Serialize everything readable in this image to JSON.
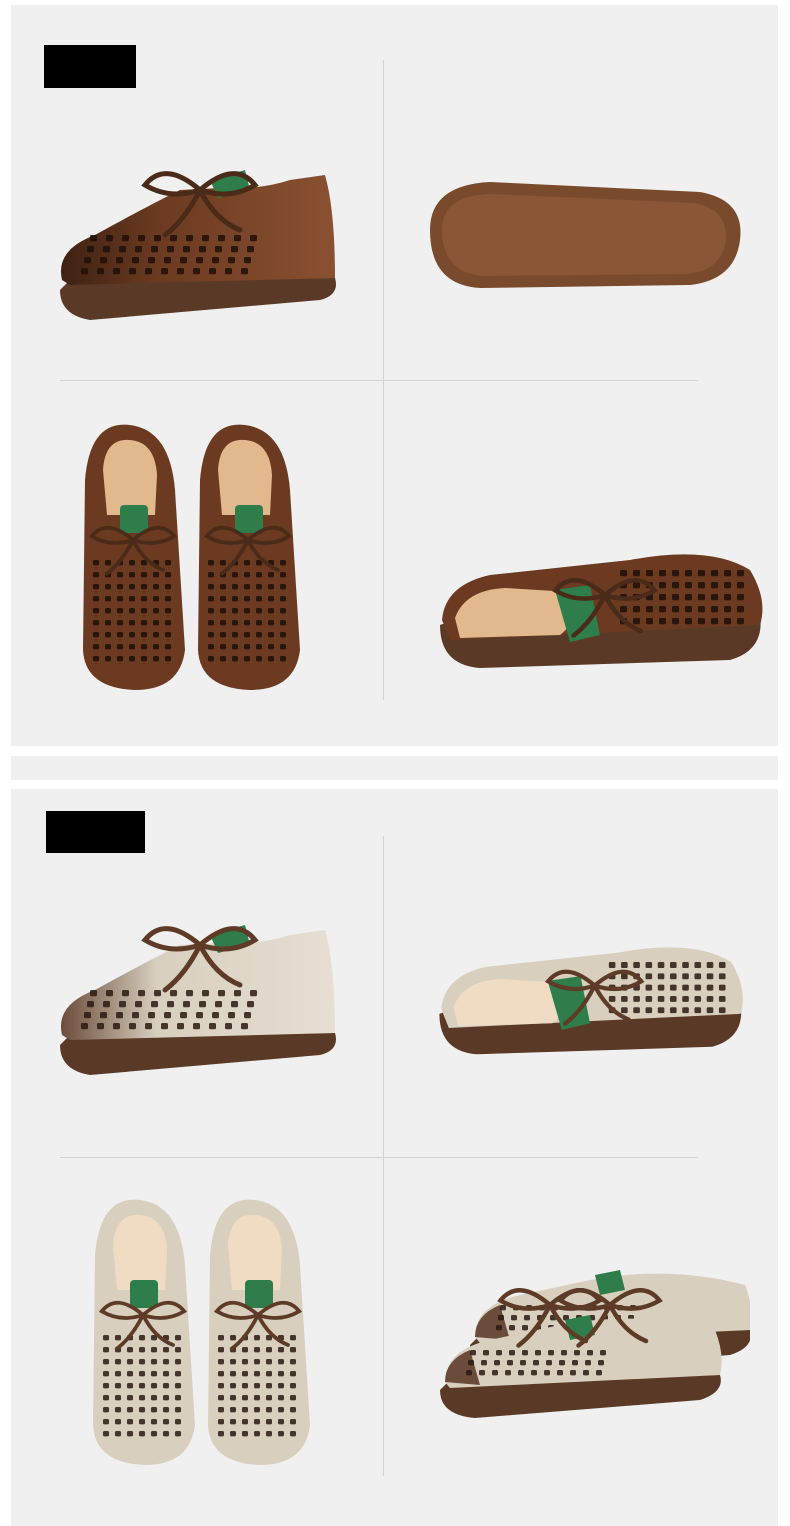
{
  "sections": [
    {
      "color_name": "brown",
      "colors": {
        "upper": "#6b3a20",
        "upper_light": "#8a5131",
        "toe": "#3e2113",
        "sole": "#5a3a26",
        "lace": "#4a2a18",
        "tab": "#2e7d4b",
        "lining": "#e2b98c",
        "holes": "#1e0f08"
      },
      "views": [
        "side-view",
        "sole-view",
        "top-pair-view",
        "rear-view"
      ]
    },
    {
      "color_name": "beige",
      "colors": {
        "upper": "#d8cfbf",
        "upper_light": "#e6dfd2",
        "toe": "#6b4c3b",
        "sole": "#5a3a26",
        "lace": "#5e3b26",
        "tab": "#2e7d4b",
        "lining": "#f0dcc2",
        "holes": "#2a1a12"
      },
      "views": [
        "side-view",
        "rear-view",
        "top-pair-view",
        "angle-pair-view"
      ]
    }
  ]
}
